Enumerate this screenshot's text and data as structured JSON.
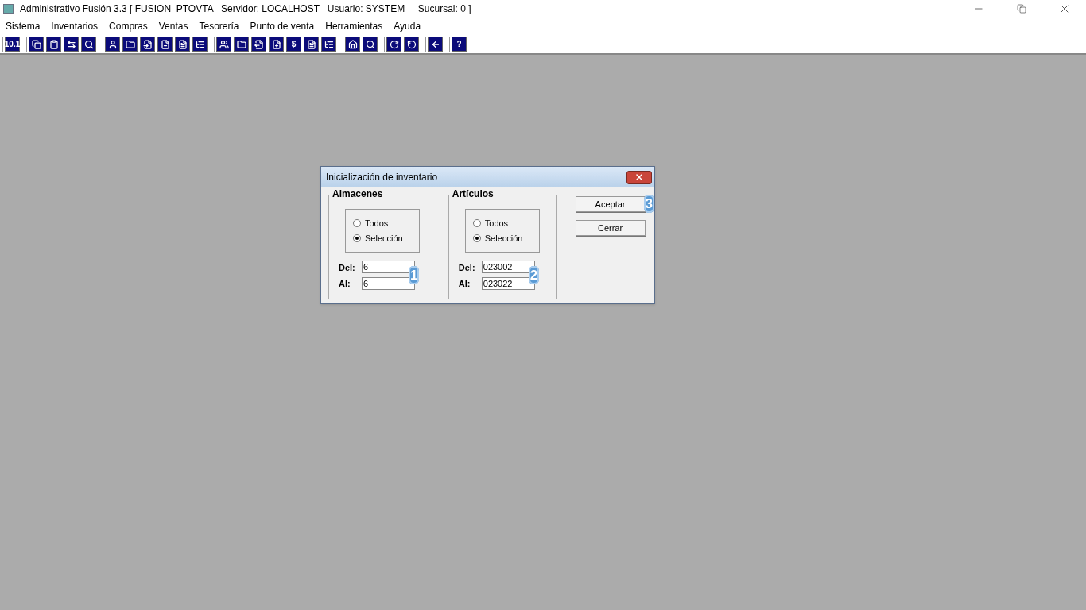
{
  "window": {
    "title": "Administrativo Fusión 3.3 [ FUSION_PTOVTA   Servidor: LOCALHOST   Usuario: SYSTEM     Sucursal: 0 ]"
  },
  "menu": [
    "Sistema",
    "Inventarios",
    "Compras",
    "Ventas",
    "Tesorería",
    "Punto de venta",
    "Herramientas",
    "Ayuda"
  ],
  "toolbar_texts": [
    "10.1",
    "$",
    "?"
  ],
  "dialog": {
    "title": "Inicialización de inventario",
    "groups": [
      {
        "title": "Almacenes",
        "options": [
          {
            "label": "Todos",
            "selected": false
          },
          {
            "label": "Selección",
            "selected": true
          }
        ],
        "fields": [
          {
            "label": "Del:",
            "value": "6"
          },
          {
            "label": "Al:",
            "value": "6"
          }
        ],
        "badge": "1"
      },
      {
        "title": "Artículos",
        "options": [
          {
            "label": "Todos",
            "selected": false
          },
          {
            "label": "Selección",
            "selected": true
          }
        ],
        "fields": [
          {
            "label": "Del:",
            "value": "023002"
          },
          {
            "label": "Al:",
            "value": "023022"
          }
        ],
        "badge": "2"
      }
    ],
    "buttons": [
      {
        "label": "Aceptar",
        "badge": "3"
      },
      {
        "label": "Cerrar"
      }
    ]
  }
}
